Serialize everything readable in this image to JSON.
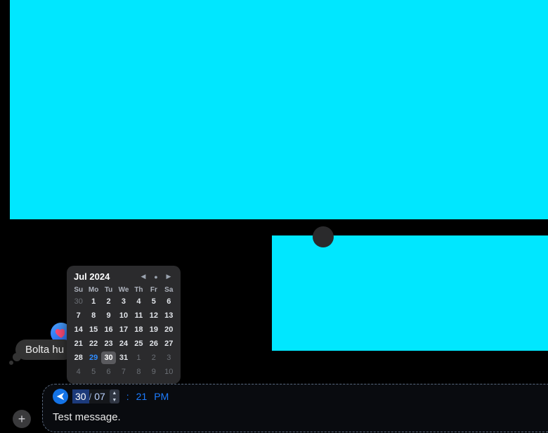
{
  "images": {
    "top_caption": "",
    "bottom_caption": ""
  },
  "received_message": {
    "text": "Bolta hu",
    "reaction": "love"
  },
  "calendar": {
    "month_label": "Jul 2024",
    "dow": [
      "Su",
      "Mo",
      "Tu",
      "We",
      "Th",
      "Fr",
      "Sa"
    ],
    "weeks": [
      [
        {
          "n": "30",
          "out": true
        },
        {
          "n": "1"
        },
        {
          "n": "2"
        },
        {
          "n": "3"
        },
        {
          "n": "4"
        },
        {
          "n": "5"
        },
        {
          "n": "6"
        }
      ],
      [
        {
          "n": "7"
        },
        {
          "n": "8"
        },
        {
          "n": "9"
        },
        {
          "n": "10"
        },
        {
          "n": "11"
        },
        {
          "n": "12"
        },
        {
          "n": "13"
        }
      ],
      [
        {
          "n": "14"
        },
        {
          "n": "15"
        },
        {
          "n": "16"
        },
        {
          "n": "17"
        },
        {
          "n": "18"
        },
        {
          "n": "19"
        },
        {
          "n": "20"
        }
      ],
      [
        {
          "n": "21"
        },
        {
          "n": "22"
        },
        {
          "n": "23"
        },
        {
          "n": "24"
        },
        {
          "n": "25"
        },
        {
          "n": "26"
        },
        {
          "n": "27"
        }
      ],
      [
        {
          "n": "28"
        },
        {
          "n": "29",
          "today": true
        },
        {
          "n": "30",
          "sel": true
        },
        {
          "n": "31"
        },
        {
          "n": "1",
          "out": true
        },
        {
          "n": "2",
          "out": true
        },
        {
          "n": "3",
          "out": true
        }
      ],
      [
        {
          "n": "4",
          "out": true
        },
        {
          "n": "5",
          "out": true
        },
        {
          "n": "6",
          "out": true
        },
        {
          "n": "7",
          "out": true
        },
        {
          "n": "8",
          "out": true
        },
        {
          "n": "9",
          "out": true
        },
        {
          "n": "10",
          "out": true
        }
      ]
    ]
  },
  "schedule": {
    "day": "30",
    "month": "07",
    "time": "21",
    "ampm": "PM"
  },
  "compose": {
    "text": "Test message."
  }
}
